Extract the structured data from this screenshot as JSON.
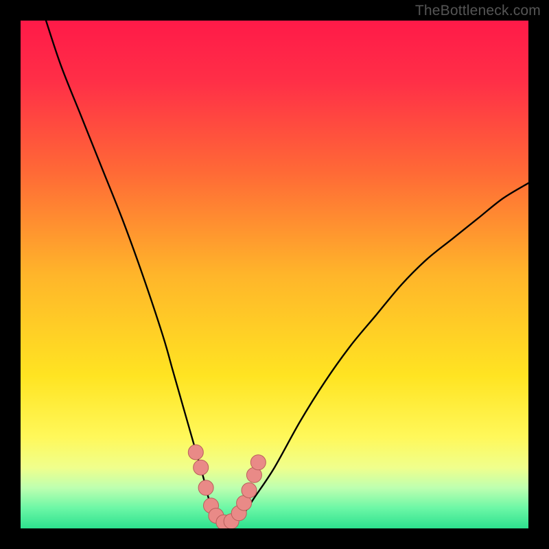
{
  "watermark": "TheBottleneck.com",
  "colors": {
    "frame": "#000000",
    "curve": "#000000",
    "marker_fill": "#e98a87",
    "marker_stroke": "#b85e5b",
    "gradient_stops": [
      {
        "offset": "0%",
        "color": "#ff1a48"
      },
      {
        "offset": "12%",
        "color": "#ff2f47"
      },
      {
        "offset": "30%",
        "color": "#ff6a36"
      },
      {
        "offset": "50%",
        "color": "#ffb52a"
      },
      {
        "offset": "70%",
        "color": "#ffe422"
      },
      {
        "offset": "82%",
        "color": "#fff85a"
      },
      {
        "offset": "88%",
        "color": "#f0ff8c"
      },
      {
        "offset": "92%",
        "color": "#beffb0"
      },
      {
        "offset": "96%",
        "color": "#6cf7a6"
      },
      {
        "offset": "100%",
        "color": "#2de18e"
      }
    ]
  },
  "chart_data": {
    "type": "line",
    "title": "",
    "xlabel": "",
    "ylabel": "",
    "xlim": [
      0,
      100
    ],
    "ylim": [
      0,
      100
    ],
    "series": [
      {
        "name": "bottleneck-curve",
        "x": [
          5,
          8,
          12,
          16,
          20,
          24,
          28,
          30,
          32,
          34,
          36,
          37,
          38,
          40,
          42,
          44,
          46,
          50,
          55,
          60,
          65,
          70,
          75,
          80,
          85,
          90,
          95,
          100
        ],
        "y": [
          100,
          91,
          81,
          71,
          61,
          50,
          38,
          31,
          24,
          17,
          10,
          6,
          3,
          1,
          1,
          3,
          6,
          12,
          21,
          29,
          36,
          42,
          48,
          53,
          57,
          61,
          65,
          68
        ]
      }
    ],
    "markers": {
      "name": "highlight-points",
      "x": [
        34.5,
        35.5,
        36.5,
        37.5,
        38.5,
        40.0,
        41.5,
        43.0,
        44.0,
        45.0,
        46.0,
        46.8
      ],
      "y": [
        15.0,
        12.0,
        8.0,
        4.5,
        2.5,
        1.2,
        1.4,
        3.0,
        5.0,
        7.5,
        10.5,
        13.0
      ]
    }
  }
}
